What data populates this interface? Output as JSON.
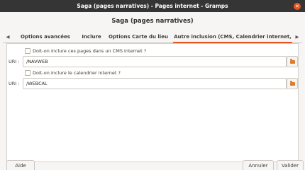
{
  "window": {
    "title": "Saga (pages narratives) - Pages internet - Gramps",
    "close_icon": "close-icon"
  },
  "dialog": {
    "header": "Saga (pages narratives)"
  },
  "tabs": [
    {
      "label": "Options avancées"
    },
    {
      "label": "Inclure"
    },
    {
      "label": "Options Carte du lieu"
    },
    {
      "label": "Autre inclusion (CMS, Calendrier internet, Php)"
    }
  ],
  "form": {
    "cms_checkbox_label": "Doit-on inclure ces pages dans un CMS internet ?",
    "cms_uri_label": "URI :",
    "cms_uri_value": "/NAVWEB",
    "calendar_checkbox_label": "Doit-on inclure le calendrier internet ?",
    "calendar_uri_label": "URI :",
    "calendar_uri_value": "/WEBCAL"
  },
  "buttons": {
    "help": "Aide",
    "cancel": "Annuler",
    "ok": "Valider"
  },
  "colors": {
    "accent": "#e95420",
    "titlebar": "#353535",
    "folder": "#e07b2a"
  }
}
